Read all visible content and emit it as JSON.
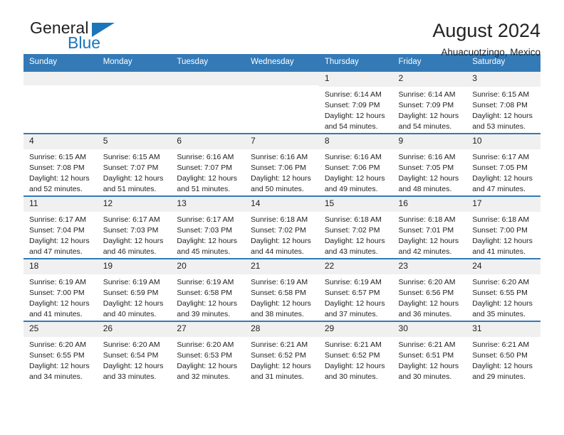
{
  "brand": {
    "name_part1": "General",
    "name_part2": "Blue",
    "triangle_icon": "triangle-icon",
    "accent_color": "#1b75bb"
  },
  "header": {
    "title": "August 2024",
    "location": "Ahuacuotzingo, Mexico"
  },
  "colors": {
    "header_blue": "#337ab7",
    "daynum_bg": "#f0f0f0",
    "text": "#222222"
  },
  "weekday_headers": [
    "Sunday",
    "Monday",
    "Tuesday",
    "Wednesday",
    "Thursday",
    "Friday",
    "Saturday"
  ],
  "labels": {
    "sunrise_prefix": "Sunrise:",
    "sunset_prefix": "Sunset:",
    "daylight_prefix": "Daylight:"
  },
  "weeks": [
    [
      {
        "day": "",
        "sunrise": "",
        "sunset": "",
        "daylight_line1": "",
        "daylight_line2": "",
        "empty": true
      },
      {
        "day": "",
        "sunrise": "",
        "sunset": "",
        "daylight_line1": "",
        "daylight_line2": "",
        "empty": true
      },
      {
        "day": "",
        "sunrise": "",
        "sunset": "",
        "daylight_line1": "",
        "daylight_line2": "",
        "empty": true
      },
      {
        "day": "",
        "sunrise": "",
        "sunset": "",
        "daylight_line1": "",
        "daylight_line2": "",
        "empty": true
      },
      {
        "day": "1",
        "sunrise": "Sunrise: 6:14 AM",
        "sunset": "Sunset: 7:09 PM",
        "daylight_line1": "Daylight: 12 hours",
        "daylight_line2": "and 54 minutes.",
        "empty": false
      },
      {
        "day": "2",
        "sunrise": "Sunrise: 6:14 AM",
        "sunset": "Sunset: 7:09 PM",
        "daylight_line1": "Daylight: 12 hours",
        "daylight_line2": "and 54 minutes.",
        "empty": false
      },
      {
        "day": "3",
        "sunrise": "Sunrise: 6:15 AM",
        "sunset": "Sunset: 7:08 PM",
        "daylight_line1": "Daylight: 12 hours",
        "daylight_line2": "and 53 minutes.",
        "empty": false
      }
    ],
    [
      {
        "day": "4",
        "sunrise": "Sunrise: 6:15 AM",
        "sunset": "Sunset: 7:08 PM",
        "daylight_line1": "Daylight: 12 hours",
        "daylight_line2": "and 52 minutes.",
        "empty": false
      },
      {
        "day": "5",
        "sunrise": "Sunrise: 6:15 AM",
        "sunset": "Sunset: 7:07 PM",
        "daylight_line1": "Daylight: 12 hours",
        "daylight_line2": "and 51 minutes.",
        "empty": false
      },
      {
        "day": "6",
        "sunrise": "Sunrise: 6:16 AM",
        "sunset": "Sunset: 7:07 PM",
        "daylight_line1": "Daylight: 12 hours",
        "daylight_line2": "and 51 minutes.",
        "empty": false
      },
      {
        "day": "7",
        "sunrise": "Sunrise: 6:16 AM",
        "sunset": "Sunset: 7:06 PM",
        "daylight_line1": "Daylight: 12 hours",
        "daylight_line2": "and 50 minutes.",
        "empty": false
      },
      {
        "day": "8",
        "sunrise": "Sunrise: 6:16 AM",
        "sunset": "Sunset: 7:06 PM",
        "daylight_line1": "Daylight: 12 hours",
        "daylight_line2": "and 49 minutes.",
        "empty": false
      },
      {
        "day": "9",
        "sunrise": "Sunrise: 6:16 AM",
        "sunset": "Sunset: 7:05 PM",
        "daylight_line1": "Daylight: 12 hours",
        "daylight_line2": "and 48 minutes.",
        "empty": false
      },
      {
        "day": "10",
        "sunrise": "Sunrise: 6:17 AM",
        "sunset": "Sunset: 7:05 PM",
        "daylight_line1": "Daylight: 12 hours",
        "daylight_line2": "and 47 minutes.",
        "empty": false
      }
    ],
    [
      {
        "day": "11",
        "sunrise": "Sunrise: 6:17 AM",
        "sunset": "Sunset: 7:04 PM",
        "daylight_line1": "Daylight: 12 hours",
        "daylight_line2": "and 47 minutes.",
        "empty": false
      },
      {
        "day": "12",
        "sunrise": "Sunrise: 6:17 AM",
        "sunset": "Sunset: 7:03 PM",
        "daylight_line1": "Daylight: 12 hours",
        "daylight_line2": "and 46 minutes.",
        "empty": false
      },
      {
        "day": "13",
        "sunrise": "Sunrise: 6:17 AM",
        "sunset": "Sunset: 7:03 PM",
        "daylight_line1": "Daylight: 12 hours",
        "daylight_line2": "and 45 minutes.",
        "empty": false
      },
      {
        "day": "14",
        "sunrise": "Sunrise: 6:18 AM",
        "sunset": "Sunset: 7:02 PM",
        "daylight_line1": "Daylight: 12 hours",
        "daylight_line2": "and 44 minutes.",
        "empty": false
      },
      {
        "day": "15",
        "sunrise": "Sunrise: 6:18 AM",
        "sunset": "Sunset: 7:02 PM",
        "daylight_line1": "Daylight: 12 hours",
        "daylight_line2": "and 43 minutes.",
        "empty": false
      },
      {
        "day": "16",
        "sunrise": "Sunrise: 6:18 AM",
        "sunset": "Sunset: 7:01 PM",
        "daylight_line1": "Daylight: 12 hours",
        "daylight_line2": "and 42 minutes.",
        "empty": false
      },
      {
        "day": "17",
        "sunrise": "Sunrise: 6:18 AM",
        "sunset": "Sunset: 7:00 PM",
        "daylight_line1": "Daylight: 12 hours",
        "daylight_line2": "and 41 minutes.",
        "empty": false
      }
    ],
    [
      {
        "day": "18",
        "sunrise": "Sunrise: 6:19 AM",
        "sunset": "Sunset: 7:00 PM",
        "daylight_line1": "Daylight: 12 hours",
        "daylight_line2": "and 41 minutes.",
        "empty": false
      },
      {
        "day": "19",
        "sunrise": "Sunrise: 6:19 AM",
        "sunset": "Sunset: 6:59 PM",
        "daylight_line1": "Daylight: 12 hours",
        "daylight_line2": "and 40 minutes.",
        "empty": false
      },
      {
        "day": "20",
        "sunrise": "Sunrise: 6:19 AM",
        "sunset": "Sunset: 6:58 PM",
        "daylight_line1": "Daylight: 12 hours",
        "daylight_line2": "and 39 minutes.",
        "empty": false
      },
      {
        "day": "21",
        "sunrise": "Sunrise: 6:19 AM",
        "sunset": "Sunset: 6:58 PM",
        "daylight_line1": "Daylight: 12 hours",
        "daylight_line2": "and 38 minutes.",
        "empty": false
      },
      {
        "day": "22",
        "sunrise": "Sunrise: 6:19 AM",
        "sunset": "Sunset: 6:57 PM",
        "daylight_line1": "Daylight: 12 hours",
        "daylight_line2": "and 37 minutes.",
        "empty": false
      },
      {
        "day": "23",
        "sunrise": "Sunrise: 6:20 AM",
        "sunset": "Sunset: 6:56 PM",
        "daylight_line1": "Daylight: 12 hours",
        "daylight_line2": "and 36 minutes.",
        "empty": false
      },
      {
        "day": "24",
        "sunrise": "Sunrise: 6:20 AM",
        "sunset": "Sunset: 6:55 PM",
        "daylight_line1": "Daylight: 12 hours",
        "daylight_line2": "and 35 minutes.",
        "empty": false
      }
    ],
    [
      {
        "day": "25",
        "sunrise": "Sunrise: 6:20 AM",
        "sunset": "Sunset: 6:55 PM",
        "daylight_line1": "Daylight: 12 hours",
        "daylight_line2": "and 34 minutes.",
        "empty": false
      },
      {
        "day": "26",
        "sunrise": "Sunrise: 6:20 AM",
        "sunset": "Sunset: 6:54 PM",
        "daylight_line1": "Daylight: 12 hours",
        "daylight_line2": "and 33 minutes.",
        "empty": false
      },
      {
        "day": "27",
        "sunrise": "Sunrise: 6:20 AM",
        "sunset": "Sunset: 6:53 PM",
        "daylight_line1": "Daylight: 12 hours",
        "daylight_line2": "and 32 minutes.",
        "empty": false
      },
      {
        "day": "28",
        "sunrise": "Sunrise: 6:21 AM",
        "sunset": "Sunset: 6:52 PM",
        "daylight_line1": "Daylight: 12 hours",
        "daylight_line2": "and 31 minutes.",
        "empty": false
      },
      {
        "day": "29",
        "sunrise": "Sunrise: 6:21 AM",
        "sunset": "Sunset: 6:52 PM",
        "daylight_line1": "Daylight: 12 hours",
        "daylight_line2": "and 30 minutes.",
        "empty": false
      },
      {
        "day": "30",
        "sunrise": "Sunrise: 6:21 AM",
        "sunset": "Sunset: 6:51 PM",
        "daylight_line1": "Daylight: 12 hours",
        "daylight_line2": "and 30 minutes.",
        "empty": false
      },
      {
        "day": "31",
        "sunrise": "Sunrise: 6:21 AM",
        "sunset": "Sunset: 6:50 PM",
        "daylight_line1": "Daylight: 12 hours",
        "daylight_line2": "and 29 minutes.",
        "empty": false
      }
    ]
  ]
}
